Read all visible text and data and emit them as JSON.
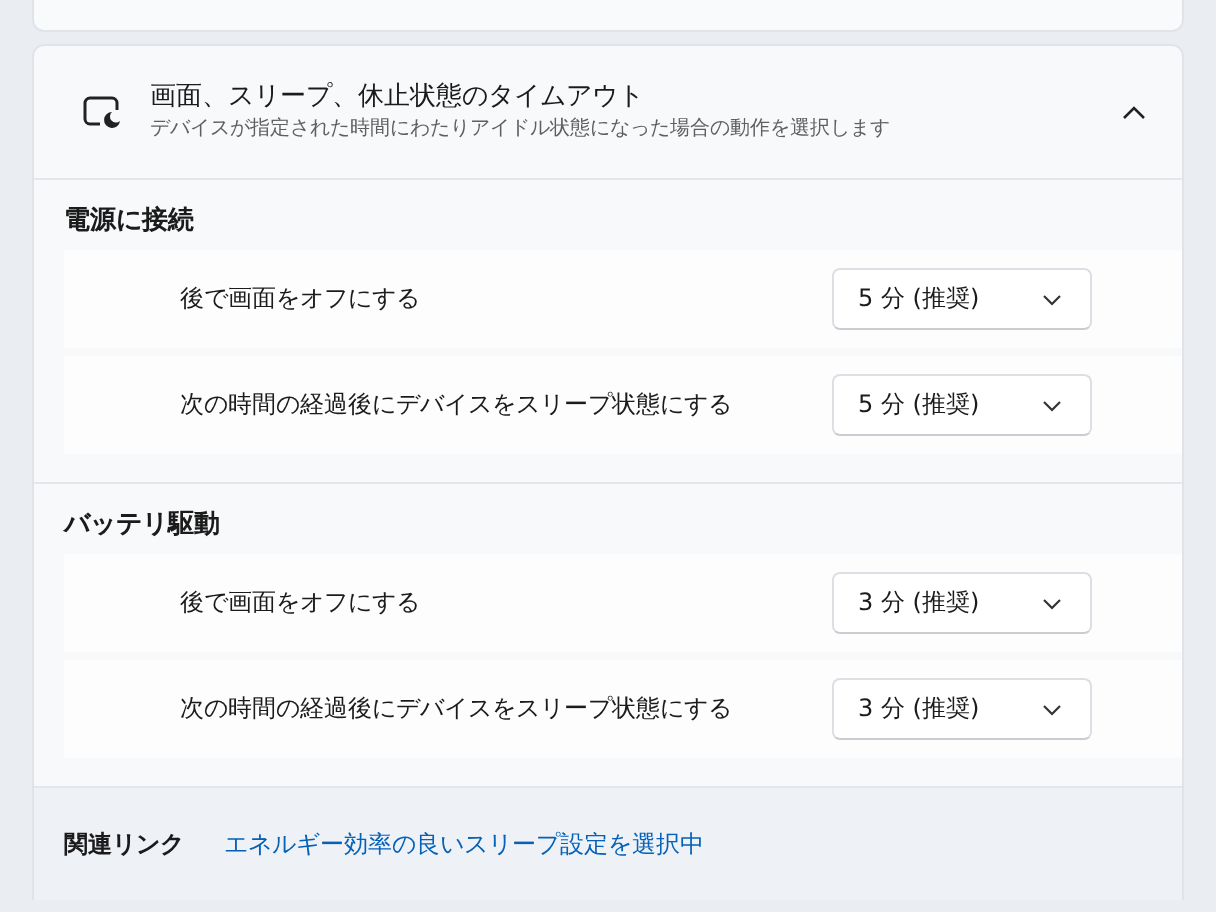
{
  "timeout_card": {
    "title": "画面、スリープ、休止状態のタイムアウト",
    "subtitle": "デバイスが指定された時間にわたりアイドル状態になった場合の動作を選択します",
    "expanded": true,
    "sections": [
      {
        "heading": "電源に接続",
        "rows": [
          {
            "label": "後で画面をオフにする",
            "value": "5 分 (推奨)"
          },
          {
            "label": "次の時間の経過後にデバイスをスリープ状態にする",
            "value": "5 分 (推奨)"
          }
        ]
      },
      {
        "heading": "バッテリ駆動",
        "rows": [
          {
            "label": "後で画面をオフにする",
            "value": "3 分 (推奨)"
          },
          {
            "label": "次の時間の経過後にデバイスをスリープ状態にする",
            "value": "3 分 (推奨)"
          }
        ]
      }
    ]
  },
  "related": {
    "label": "関連リンク",
    "link": "エネルギー効率の良いスリープ設定を選択中"
  }
}
